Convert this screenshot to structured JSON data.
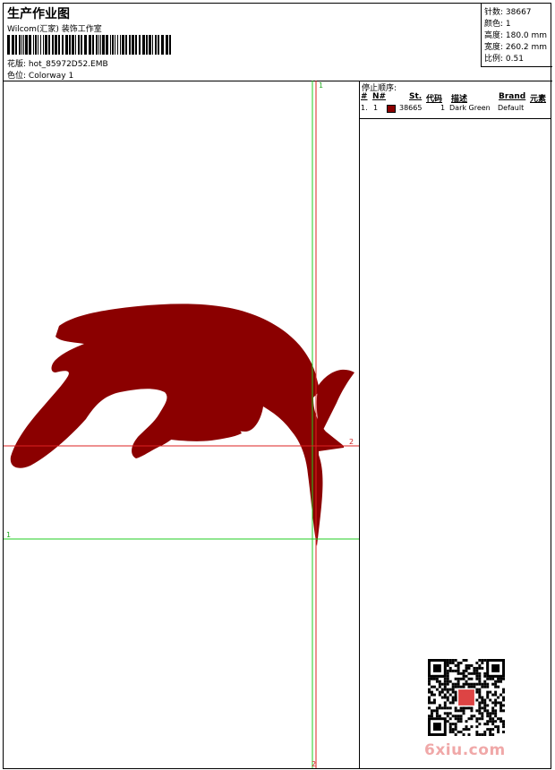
{
  "header": {
    "title": "生产作业图",
    "subtitle": "Wilcom(汇家) 装饰工作室",
    "design_file_label": "花版:",
    "design_file": "hot_85972D52.EMB",
    "colorway_label": "色位:",
    "colorway": "Colorway 1"
  },
  "stats": {
    "stitches": "针数: 38667",
    "colors": "颜色: 1",
    "height": "高度: 180.0 mm",
    "width": "宽度: 260.2 mm",
    "scale": "比例: 0.51"
  },
  "stop_sequence": {
    "title": "停止顺序:",
    "columns": [
      "#",
      "N#",
      "St.",
      "代码",
      "描述",
      "Brand",
      "元素"
    ],
    "rows": [
      {
        "index": "1.",
        "needle": "1",
        "stitches": "38665",
        "code": "1",
        "description": "Dark Green",
        "brand": "Default",
        "element": "",
        "swatch_color": "#8b0000"
      }
    ]
  },
  "guides": {
    "green_v_top": "1",
    "green_h_left": "1",
    "red_h_right": "2",
    "red_v_bottom": "2"
  },
  "colors": {
    "thread": "#8b0000",
    "guide_green": "#22cc22",
    "guide_red": "#dd2222",
    "watermark": "#f0a8a8"
  },
  "watermark": "6xiu.com"
}
